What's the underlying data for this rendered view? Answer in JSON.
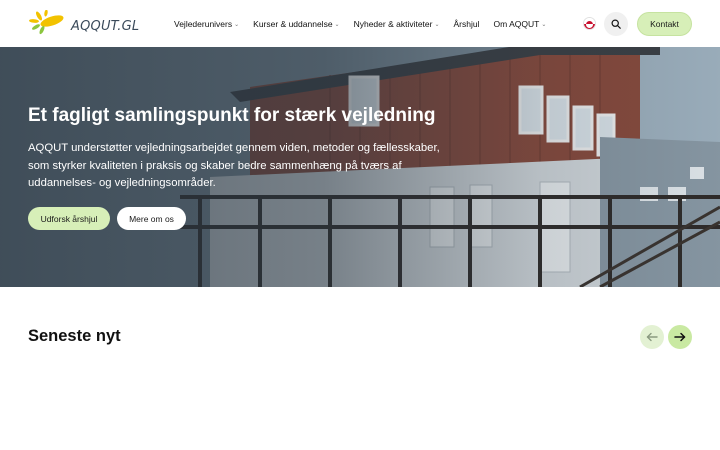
{
  "header": {
    "logo_text": "AQQUT.GL",
    "nav": [
      {
        "label": "Vejlederunivers",
        "has_dropdown": true
      },
      {
        "label": "Kurser & uddannelse",
        "has_dropdown": true
      },
      {
        "label": "Nyheder & aktiviteter",
        "has_dropdown": true
      },
      {
        "label": "Årshjul",
        "has_dropdown": false
      },
      {
        "label": "Om AQQUT",
        "has_dropdown": true
      }
    ],
    "dropdown_icon": "chevron-down-icon",
    "language_icon": "greenland-flag-icon",
    "search_icon": "search-icon",
    "contact_label": "Kontakt"
  },
  "hero": {
    "title": "Et fagligt samlingspunkt for stærk vejledning",
    "text": "AQQUT understøtter vejledningsarbejdet gennem viden, metoder og fællesskaber, som styrker kvaliteten i praksis og skaber bedre sammenhæng på tværs af uddannelses- og vejledningsområder.",
    "primary_button": "Udforsk årshjul",
    "secondary_button": "Mere om os"
  },
  "news": {
    "title": "Seneste nyt",
    "prev_icon": "arrow-left-icon",
    "next_icon": "arrow-right-icon"
  },
  "colors": {
    "accent": "#d7efb8",
    "arrow_next": "#c9e9a2",
    "arrow_prev": "#e3f1d3",
    "overlay": "#28343f",
    "logo_yellow": "#f2c200",
    "logo_green": "#8cc63f"
  }
}
